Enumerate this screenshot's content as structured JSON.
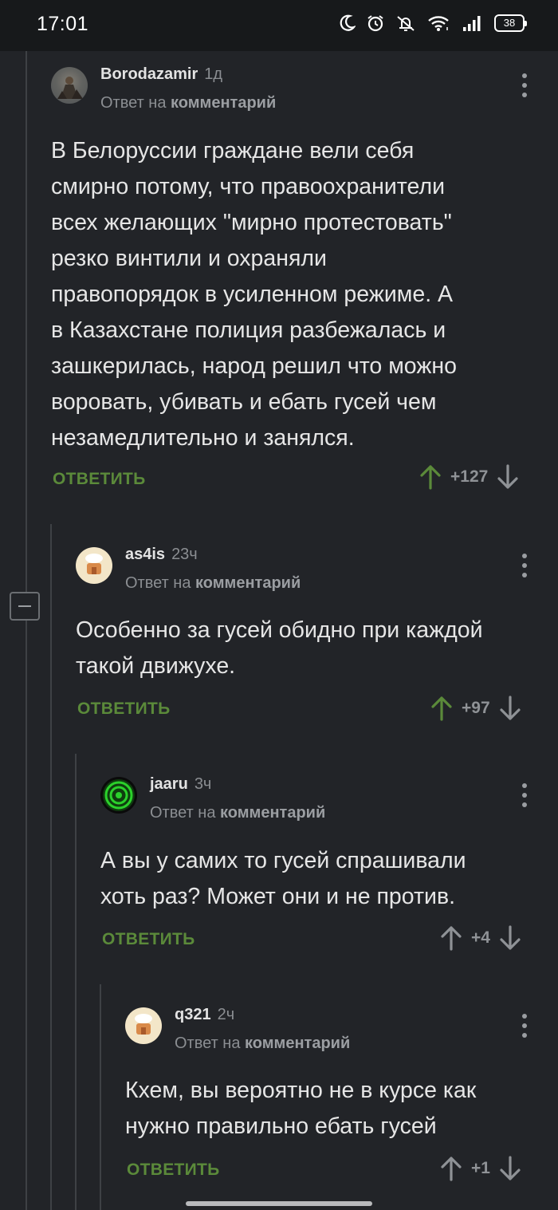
{
  "status_bar": {
    "time": "17:01",
    "battery": "38",
    "icons": [
      "moon-icon",
      "alarm-icon",
      "silent-bell-icon",
      "wifi-icon",
      "signal-icon",
      "battery-icon"
    ]
  },
  "colors": {
    "background": "#222428",
    "accent_green": "#5b8a3a",
    "upvote_active": "#5b8a3a",
    "muted": "#8b8e92"
  },
  "comments": [
    {
      "author": "Borodazamir",
      "time": "1д",
      "reply_prefix": "Ответ на",
      "reply_target": "комментарий",
      "text_lines": [
        "В Белоруссии граждане вели себя",
        "смирно потому, что правоохранители",
        "всех желающих \"мирно протестовать\"",
        "резко винтили и охраняли",
        "правопорядок в усиленном режиме. А",
        "в Казахстане полиция разбежалась и",
        "зашкерилась, народ решил что можно",
        "воровать, убивать и ебать гусей чем",
        "незамедлительно и занялся."
      ],
      "reply_label": "ОТВЕТИТЬ",
      "score": "+127",
      "upvoted": true
    },
    {
      "author": "as4is",
      "time": "23ч",
      "reply_prefix": "Ответ на",
      "reply_target": "комментарий",
      "text_lines": [
        "Особенно за гусей обидно при каждой",
        "такой движухе."
      ],
      "reply_label": "ОТВЕТИТЬ",
      "score": "+97",
      "upvoted": true
    },
    {
      "author": "jaaru",
      "time": "3ч",
      "reply_prefix": "Ответ на",
      "reply_target": "комментарий",
      "text_lines": [
        "А вы у самих то гусей спрашивали",
        "хоть раз? Может они и не против."
      ],
      "reply_label": "ОТВЕТИТЬ",
      "score": "+4",
      "upvoted": false
    },
    {
      "author": "q321",
      "time": "2ч",
      "reply_prefix": "Ответ на",
      "reply_target": "комментарий",
      "text_lines": [
        "Кхем, вы вероятно не в курсе как",
        "нужно правильно ебать гусей"
      ],
      "reply_label": "ОТВЕТИТЬ",
      "score": "+1",
      "upvoted": false
    }
  ]
}
